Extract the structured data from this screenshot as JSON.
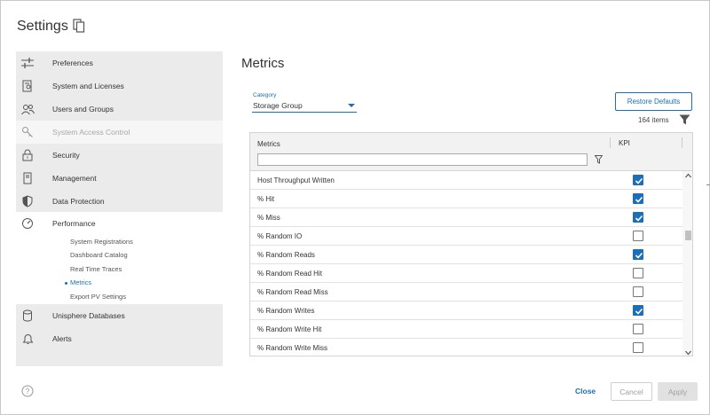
{
  "header": {
    "title": "Settings",
    "copy_icon": "copy-icon"
  },
  "sidebar": {
    "items": [
      {
        "label": "Preferences",
        "icon": "sliders-icon"
      },
      {
        "label": "System and Licenses",
        "icon": "license-icon"
      },
      {
        "label": "Users and Groups",
        "icon": "users-icon"
      },
      {
        "label": "System Access Control",
        "icon": "key-icon",
        "disabled": true
      },
      {
        "label": "Security",
        "icon": "lock-icon"
      },
      {
        "label": "Management",
        "icon": "server-icon"
      },
      {
        "label": "Data Protection",
        "icon": "shield-icon"
      },
      {
        "label": "Performance",
        "icon": "gauge-icon"
      },
      {
        "label": "Unisphere Databases",
        "icon": "database-icon"
      },
      {
        "label": "Alerts",
        "icon": "bell-icon"
      }
    ],
    "performance_sub": [
      {
        "label": "System Registrations"
      },
      {
        "label": "Dashboard Catalog"
      },
      {
        "label": "Real Time Traces"
      },
      {
        "label": "Metrics",
        "active": true
      },
      {
        "label": "Export PV Settings"
      }
    ]
  },
  "main": {
    "title": "Metrics",
    "category": {
      "label": "Category",
      "value": "Storage Group"
    },
    "restore_label": "Restore Defaults",
    "count_text": "164 items",
    "grid": {
      "columns": [
        "Metrics",
        "KPI"
      ],
      "filter_value": "",
      "rows": [
        {
          "name": "Host Throughput Written",
          "kpi": true
        },
        {
          "name": "% Hit",
          "kpi": true
        },
        {
          "name": "% Miss",
          "kpi": true
        },
        {
          "name": "% Random IO",
          "kpi": false
        },
        {
          "name": "% Random Reads",
          "kpi": true
        },
        {
          "name": "% Random Read Hit",
          "kpi": false
        },
        {
          "name": "% Random Read Miss",
          "kpi": false
        },
        {
          "name": "% Random Writes",
          "kpi": true
        },
        {
          "name": "% Random Write Hit",
          "kpi": false
        },
        {
          "name": "% Random Write Miss",
          "kpi": false
        }
      ]
    }
  },
  "footer": {
    "close_label": "Close",
    "cancel_label": "Cancel",
    "apply_label": "Apply"
  },
  "colors": {
    "accent": "#1a6fb8",
    "sidebar_bg": "#ebebeb"
  }
}
